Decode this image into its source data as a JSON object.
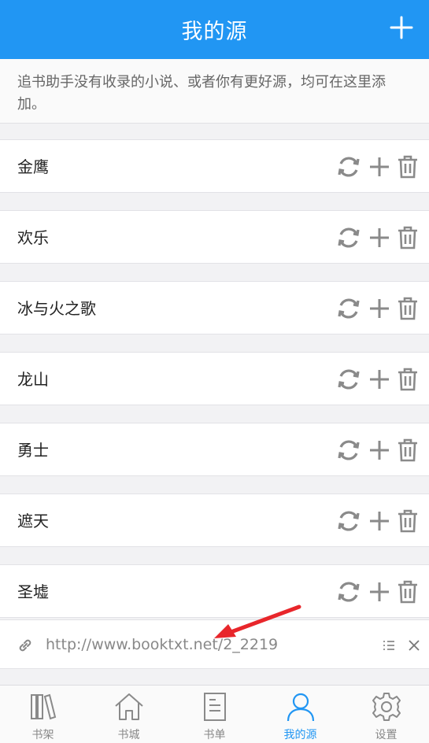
{
  "header": {
    "title": "我的源"
  },
  "notice": {
    "text": "追书助手没有收录的小说、或者你有更好源，均可在这里添加。"
  },
  "sources": [
    {
      "name": "金鹰"
    },
    {
      "name": "欢乐"
    },
    {
      "name": "冰与火之歌"
    },
    {
      "name": "龙山"
    },
    {
      "name": "勇士"
    },
    {
      "name": "遮天"
    },
    {
      "name": "圣墟"
    }
  ],
  "url_bar": {
    "url": "http://www.booktxt.net/2_2219"
  },
  "tabs": [
    {
      "label": "书架",
      "icon": "bookshelf-icon"
    },
    {
      "label": "书城",
      "icon": "home-icon"
    },
    {
      "label": "书单",
      "icon": "document-icon"
    },
    {
      "label": "我的源",
      "icon": "user-icon",
      "active": true
    },
    {
      "label": "设置",
      "icon": "gear-icon"
    }
  ],
  "colors": {
    "accent": "#2196f3",
    "icon_gray": "#8a8a8a",
    "arrow": "#e8262b"
  }
}
